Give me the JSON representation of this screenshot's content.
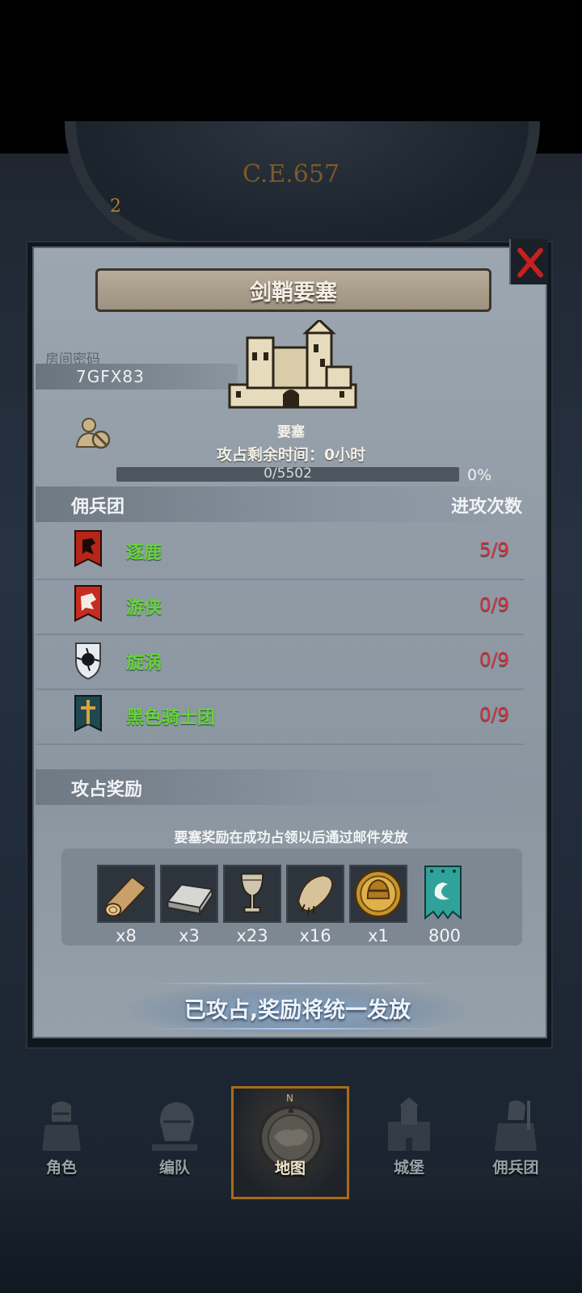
{
  "header": {
    "era": "C.E.657",
    "era_side_number": "2"
  },
  "panel": {
    "title": "剑鞘要塞",
    "room": {
      "label": "房间密码",
      "code": "7GFX83"
    },
    "fort": {
      "type_label": "要塞",
      "remaining_time": "攻占剩余时间：0小时"
    },
    "progress": {
      "text": "0/5502",
      "percent_text": "0%",
      "value": 0
    },
    "mercenary_section": {
      "title": "佣兵团",
      "right_title": "进攻次数"
    },
    "mercenaries": [
      {
        "name": "逐鹿",
        "attacks": "5/9"
      },
      {
        "name": "游侠",
        "attacks": "0/9"
      },
      {
        "name": "旋涡",
        "attacks": "0/9"
      },
      {
        "name": "黑色骑士团",
        "attacks": "0/9"
      }
    ],
    "reward_section": {
      "title": "攻占奖励",
      "note": "要塞奖励在成功占领以后通过邮件发放"
    },
    "rewards": [
      {
        "icon": "wood-log-icon",
        "qty": "x8"
      },
      {
        "icon": "iron-ingot-icon",
        "qty": "x3"
      },
      {
        "icon": "goblet-icon",
        "qty": "x23"
      },
      {
        "icon": "fur-pelt-icon",
        "qty": "x16"
      },
      {
        "icon": "knight-helmet-coin-icon",
        "qty": "x1"
      },
      {
        "icon": "guild-banner-icon",
        "qty": "800"
      }
    ],
    "claim_button": "已攻占,奖励将统一发放"
  },
  "nav": {
    "compass_letter": "N",
    "items": [
      {
        "label": "角色"
      },
      {
        "label": "编队"
      },
      {
        "label": "地图"
      },
      {
        "label": "城堡"
      },
      {
        "label": "佣兵团"
      }
    ],
    "active_index": 2
  },
  "colors": {
    "accent_green": "#6ad13b",
    "count_red": "#d7313b",
    "close_red": "#c8201c",
    "nav_active_border": "#a86b1a"
  }
}
